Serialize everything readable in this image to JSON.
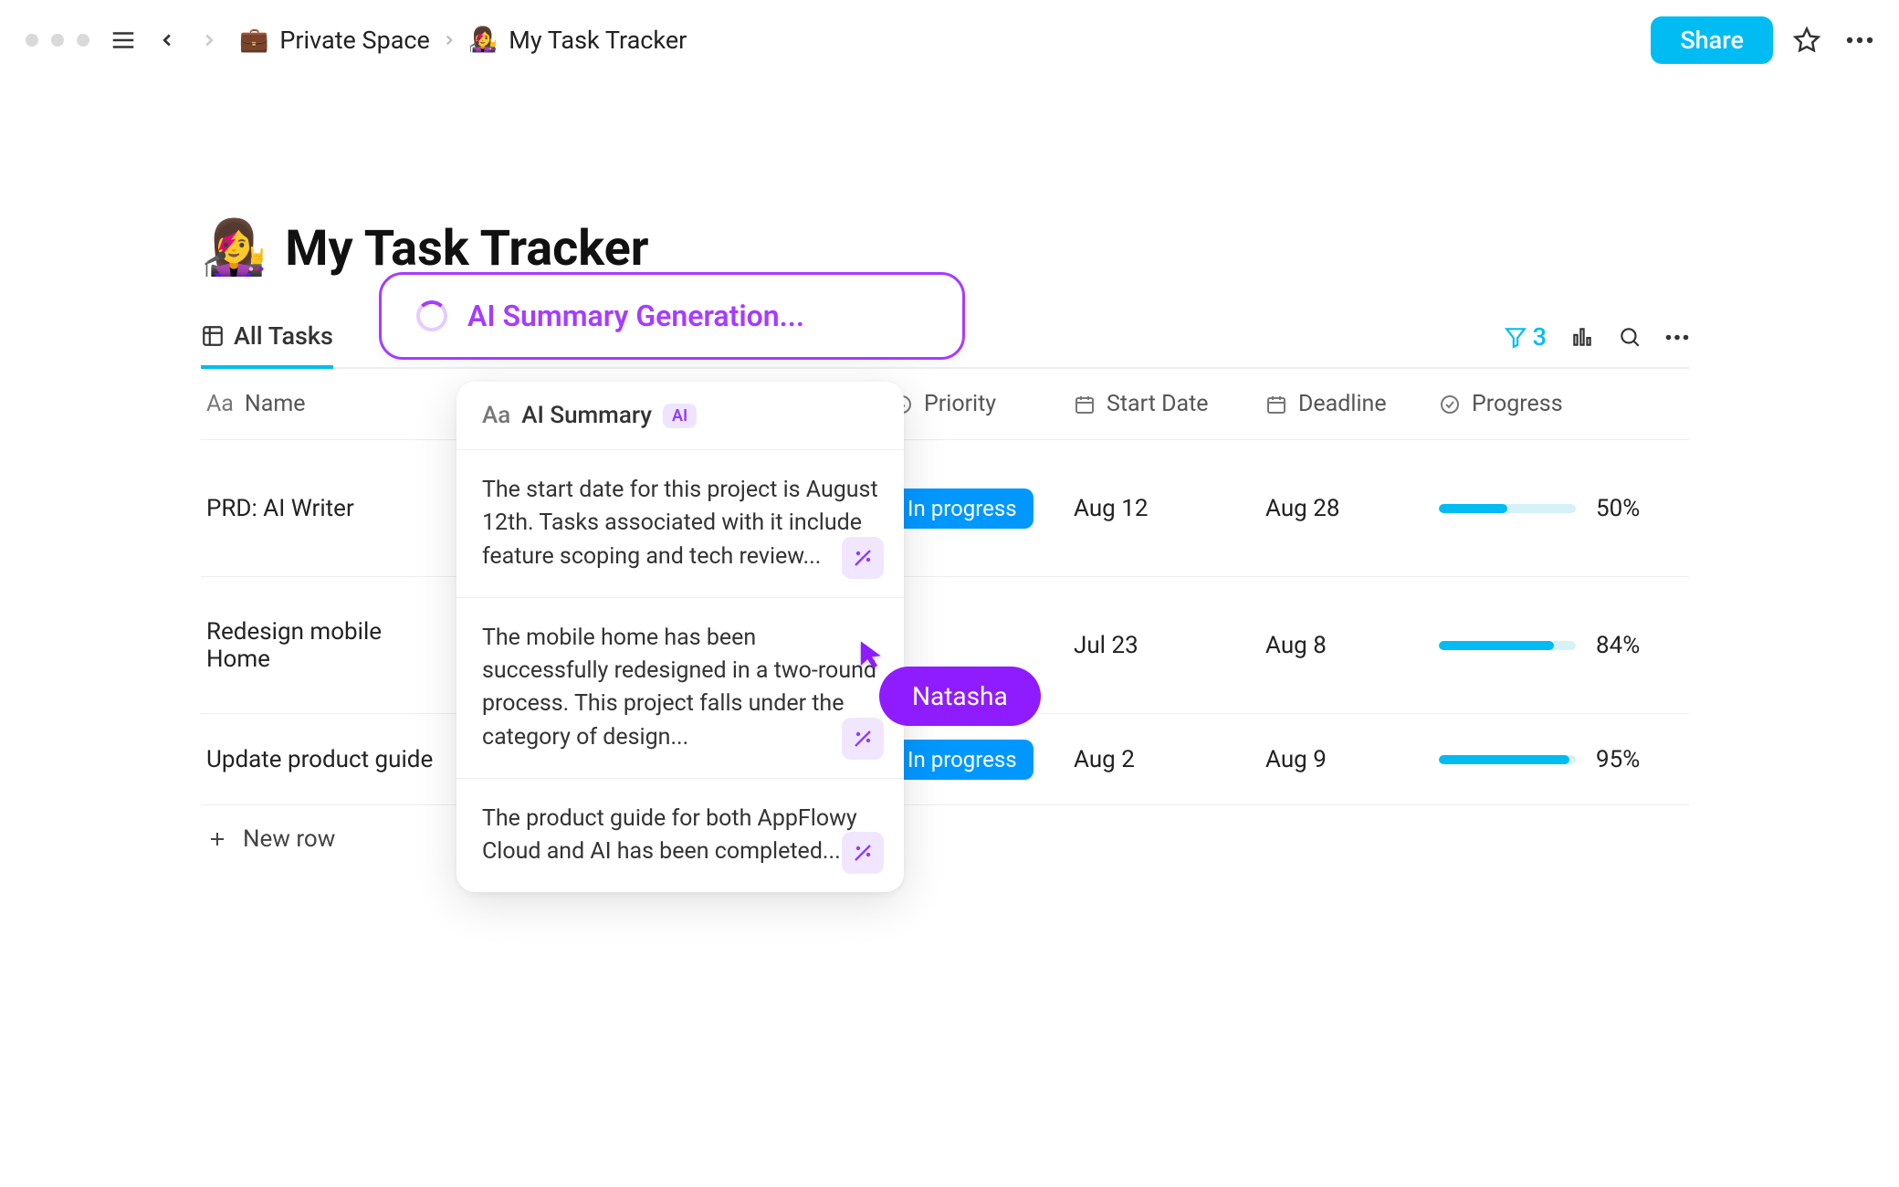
{
  "topbar": {
    "breadcrumb": {
      "space_emoji": "💼",
      "space": "Private Space",
      "page_emoji": "👩‍🎤",
      "page": "My Task Tracker"
    },
    "share_label": "Share"
  },
  "page": {
    "emoji": "👩‍🎤",
    "title": "My Task Tracker"
  },
  "tabs": {
    "active": "All Tasks"
  },
  "filter_count": "3",
  "columns": {
    "name": "Name",
    "ai_summary": "AI Summary",
    "ai_badge": "AI",
    "priority": "Priority",
    "start_date": "Start Date",
    "deadline": "Deadline",
    "progress": "Progress"
  },
  "rows": [
    {
      "name": "PRD: AI Writer",
      "summary": "The start date for this project is August 12th. Tasks associated with it include feature scoping and tech review...",
      "priority": "In progress",
      "start": "Aug 12",
      "deadline": "Aug 28",
      "progress_pct": 50,
      "progress_label": "50%"
    },
    {
      "name": "Redesign mobile Home",
      "summary": "The mobile home has been successfully redesigned in a two-round process. This project falls under the category of design...",
      "priority": "",
      "start": "Jul 23",
      "deadline": "Aug 8",
      "progress_pct": 84,
      "progress_label": "84%"
    },
    {
      "name": "Update product guide",
      "summary": "The product guide for both AppFlowy Cloud and AI has been completed....",
      "priority": "In progress",
      "start": "Aug 2",
      "deadline": "Aug 9",
      "progress_pct": 95,
      "progress_label": "95%"
    }
  ],
  "ai_banner": "AI Summary Generation...",
  "new_row_label": "New row",
  "collaborator": "Natasha"
}
